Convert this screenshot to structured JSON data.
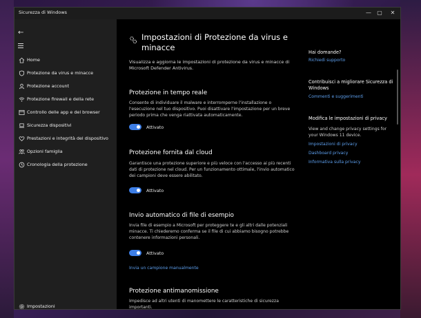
{
  "window": {
    "title": "Sicurezza di Windows",
    "minimize": "—",
    "maximize": "▢",
    "close": "✕"
  },
  "sidebar": {
    "back_icon": "arrow-left-icon",
    "menu_icon": "hamburger-icon",
    "items": [
      {
        "label": "Home",
        "icon": "home-icon"
      },
      {
        "label": "Protezione da virus e minacce",
        "icon": "shield-icon"
      },
      {
        "label": "Protezione account",
        "icon": "person-icon"
      },
      {
        "label": "Protezione firewall e della rete",
        "icon": "wifi-icon"
      },
      {
        "label": "Controllo delle app e del browser",
        "icon": "browser-icon"
      },
      {
        "label": "Sicurezza dispositivi",
        "icon": "laptop-icon"
      },
      {
        "label": "Prestazioni e integrità del dispositivo",
        "icon": "heart-icon"
      },
      {
        "label": "Opzioni famiglia",
        "icon": "family-icon"
      },
      {
        "label": "Cronologia della protezione",
        "icon": "history-icon"
      }
    ],
    "settings": {
      "label": "Impostazioni",
      "icon": "gear-icon"
    }
  },
  "main": {
    "title": "Impostazioni di Protezione da virus e minacce",
    "subtitle": "Visualizza e aggiorna le impostazioni di protezione da virus e minacce di Microsoft Defender Antivirus.",
    "sections": [
      {
        "heading": "Protezione in tempo reale",
        "text": "Consente di individuare il malware e interromperne l'installazione o l'esecuzione nel tuo dispositivo. Puoi disattivare l'impostazione per un breve periodo prima che venga riattivata automaticamente.",
        "toggle_label": "Attivato"
      },
      {
        "heading": "Protezione fornita dal cloud",
        "text": "Garantisce una protezione superiore e più veloce con l'accesso ai più recenti dati di protezione nel cloud. Per un funzionamento ottimale, l'invio automatico dei campioni deve essere abilitato.",
        "toggle_label": "Attivato"
      },
      {
        "heading": "Invio automatico di file di esempio",
        "text": "Invia file di esempio a Microsoft per proteggere te e gli altri dalle potenziali minacce. Ti chiederemo conferma se il file di cui abbiamo bisogno potrebbe contenere informazioni personali.",
        "toggle_label": "Attivato",
        "link": "Invia un campione manualmente"
      },
      {
        "heading": "Protezione antimanomissione",
        "text": "Impedisce ad altri utenti di manomettere le caratteristiche di sicurezza importanti."
      }
    ]
  },
  "right": {
    "help_heading": "Hai domande?",
    "help_link": "Richiedi supporto",
    "contrib_heading": "Contribuisci a migliorare Sicurezza di Windows",
    "contrib_link": "Commenti e suggerimenti",
    "privacy_heading": "Modifica le impostazioni di privacy",
    "privacy_text": "View and change privacy settings for your Windows 11 device.",
    "privacy_links": [
      "Impostazioni di privacy",
      "Dashboard privacy",
      "Informativa sulla privacy"
    ]
  },
  "colors": {
    "accent": "#3d7ee6",
    "link": "#5ea0ef",
    "sidebar_bg": "#1f1f1f",
    "content_bg": "#000000"
  }
}
